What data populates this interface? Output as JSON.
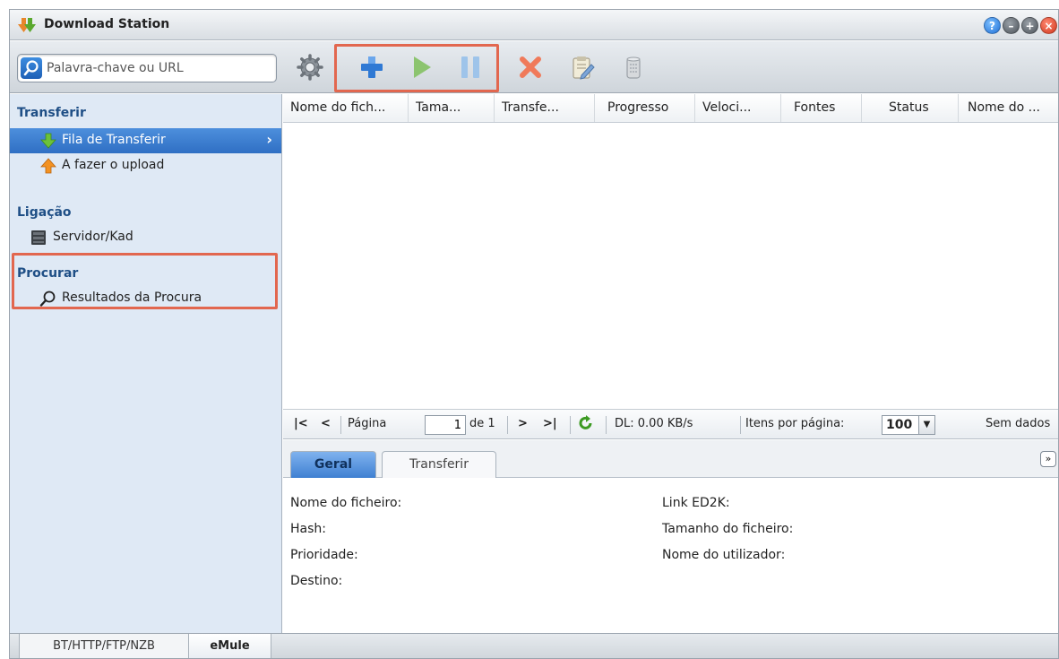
{
  "window": {
    "title": "Download Station",
    "controls": [
      "help-icon",
      "minimize-icon",
      "maximize-icon",
      "close-icon"
    ]
  },
  "toolbar": {
    "search_placeholder": "Palavra-chave ou URL",
    "buttons": [
      "settings-icon",
      "add-icon",
      "play-icon",
      "pause-icon",
      "delete-icon",
      "edit-icon",
      "clear-icon"
    ]
  },
  "sidebar": {
    "sections": [
      {
        "title": "Transferir",
        "items": [
          {
            "label": "Fila de Transferir",
            "icon": "download-arrow-icon",
            "selected": true
          },
          {
            "label": "A fazer o upload",
            "icon": "upload-arrow-icon",
            "selected": false
          }
        ]
      },
      {
        "title": "Ligação",
        "items": [
          {
            "label": "Servidor/Kad",
            "icon": "server-icon",
            "selected": false
          }
        ]
      },
      {
        "title": "Procurar",
        "items": [
          {
            "label": "Resultados da Procura",
            "icon": "search-icon",
            "selected": false
          }
        ]
      }
    ]
  },
  "grid": {
    "columns": [
      "Nome do fich...",
      "Tama...",
      "Transfe...",
      "Progresso",
      "Veloci...",
      "Fontes",
      "Status",
      "Nome do ..."
    ]
  },
  "pager": {
    "page_label": "Página",
    "page_value": "1",
    "of_label": "de 1",
    "dl_speed": "DL: 0.00 KB/s",
    "per_page_label": "Itens por página:",
    "per_page_value": "100",
    "status": "Sem dados"
  },
  "details": {
    "tabs": [
      "Geral",
      "Transferir"
    ],
    "fields_left": [
      "Nome do ficheiro:",
      "Hash:",
      "Prioridade:",
      "Destino:"
    ],
    "fields_right": [
      "Link ED2K:",
      "Tamanho do ficheiro:",
      "Nome do utilizador:"
    ]
  },
  "bottom_tabs": [
    "BT/HTTP/FTP/NZB",
    "eMule"
  ],
  "colors": {
    "highlight": "#e2674f",
    "selection": "#3a7bd0",
    "sidebar_bg": "#dfe9f5",
    "section_title": "#1f4f86"
  }
}
